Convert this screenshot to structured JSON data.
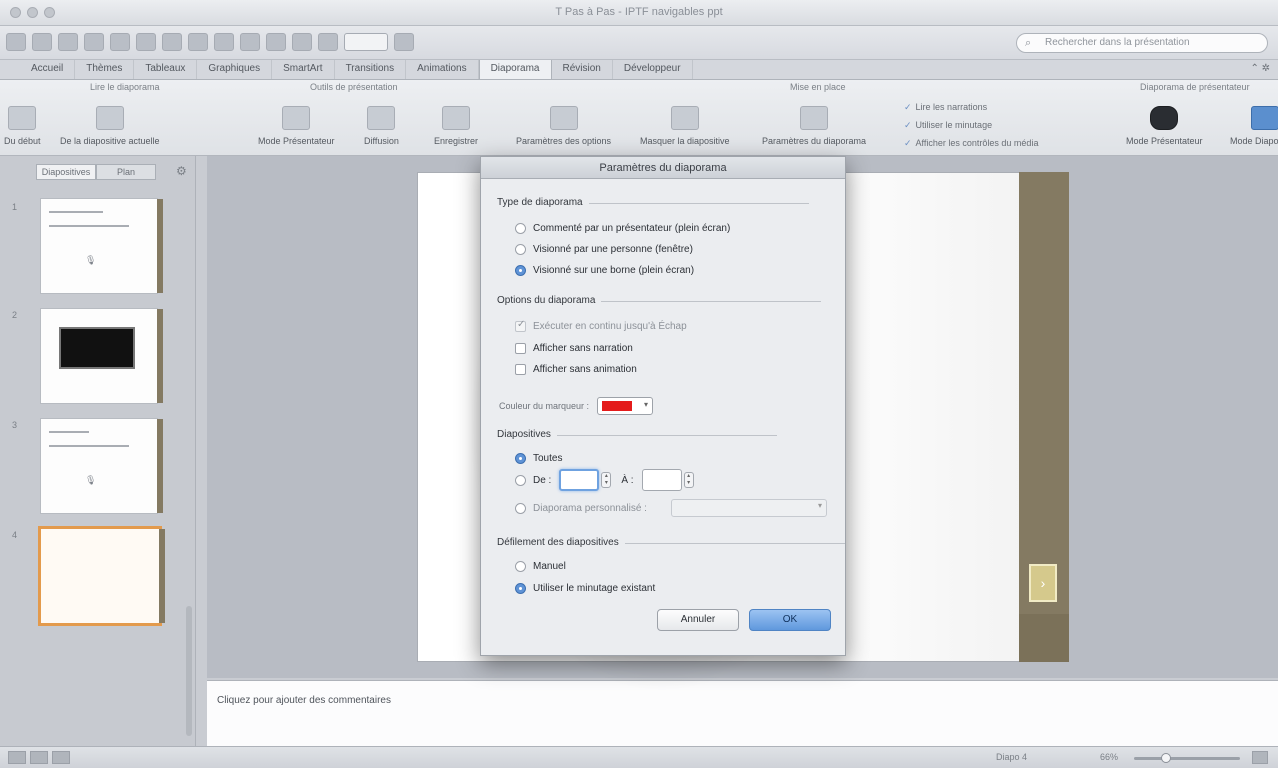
{
  "window": {
    "title": "T Pas à Pas - IPTF navigables ppt"
  },
  "search": {
    "placeholder": "Rechercher dans la présentation"
  },
  "ribbon_tabs": [
    "Accueil",
    "Thèmes",
    "Tableaux",
    "Graphiques",
    "SmartArt",
    "Transitions",
    "Animations",
    "Diaporama",
    "Révision",
    "Développeur"
  ],
  "ribbon_tab_active_index": 7,
  "ribbon": {
    "group_labels": [
      "Lire le diaporama",
      "Outils de présentation",
      "Mise en place",
      "Diaporama de présentateur"
    ],
    "buttons": [
      "Du début",
      "De la diapositive actuelle",
      "Mode Présentateur",
      "Diffusion",
      "Enregistrer",
      "Paramètres des options",
      "Masquer la diapositive",
      "Paramètres du diaporama",
      "Mode Présentateur",
      "Mode Diaporama"
    ],
    "checks": [
      "Lire les narrations",
      "Utiliser le minutage",
      "Afficher les contrôles du média"
    ]
  },
  "slide_panel": {
    "tabs": [
      "Diapositives",
      "Plan"
    ],
    "slides": [
      {
        "num": "1",
        "mini": "🎙"
      },
      {
        "num": "2",
        "mini": ""
      },
      {
        "num": "3",
        "mini": "🎙"
      },
      {
        "num": "4",
        "mini": ""
      }
    ]
  },
  "slide": {
    "nav_button": "›"
  },
  "notes": {
    "placeholder": "Cliquez pour ajouter des commentaires"
  },
  "statusbar": {
    "page": "Diapo 4",
    "zoom": "66%",
    "zoom_level": 0.28
  },
  "dialog": {
    "title": "Paramètres du diaporama",
    "section_type": "Type de diaporama",
    "type_options": [
      {
        "label": "Commenté par un présentateur (plein écran)",
        "selected": false
      },
      {
        "label": "Visionné par une personne (fenêtre)",
        "selected": false
      },
      {
        "label": "Visionné sur une borne (plein écran)",
        "selected": true
      }
    ],
    "section_options": "Options du diaporama",
    "show_options": [
      {
        "label": "Exécuter en continu jusqu'à Échap",
        "checked": true,
        "disabled": true
      },
      {
        "label": "Afficher sans narration",
        "checked": false,
        "disabled": false
      },
      {
        "label": "Afficher sans animation",
        "checked": false,
        "disabled": false
      }
    ],
    "pen_color_label": "Couleur du marqueur :",
    "pen_color": "#e41b1b",
    "section_slides": "Diapositives",
    "slides_all": "Toutes",
    "slides_from": "De :",
    "slides_to": "À :",
    "custom_show": "Diaporama personnalisé :",
    "section_advance": "Défilement des diapositives",
    "advance_options": [
      {
        "label": "Manuel",
        "selected": false
      },
      {
        "label": "Utiliser le minutage existant",
        "selected": true
      }
    ],
    "cancel_label": "Annuler",
    "ok_label": "OK"
  }
}
